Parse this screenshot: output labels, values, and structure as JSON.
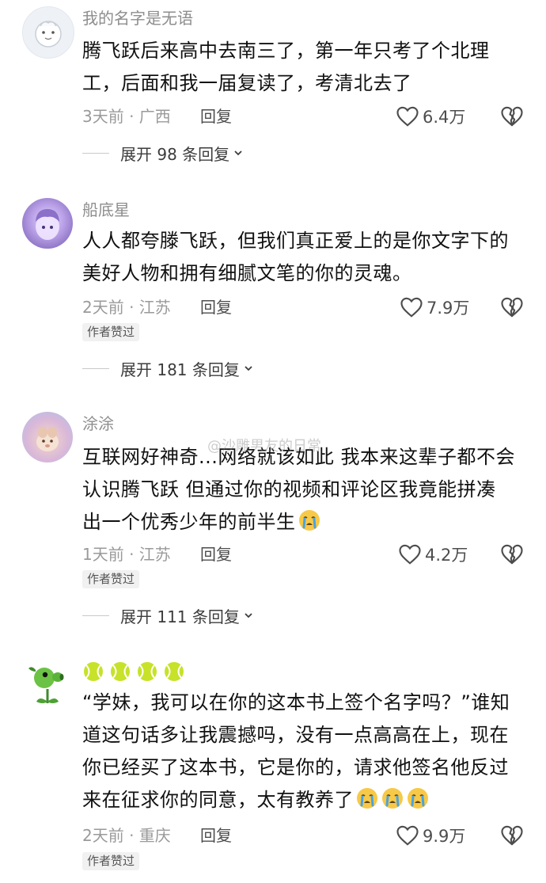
{
  "comments": [
    {
      "username": "我的名字是无语",
      "text_lines": [
        "腾飞跃后来高中去南三了，第一年只考了个北理",
        "工，后面和我一届复读了，考清北去了"
      ],
      "meta": "3天前 · 广西",
      "reply_label": "回复",
      "likes": "6.4万",
      "expand": "展开 98 条回复"
    },
    {
      "username": "船底星",
      "text_lines": [
        "人人都夸滕飞跃，但我们真正爱上的是你文字下的",
        "美好人物和拥有细腻文笔的你的灵魂。"
      ],
      "meta": "2天前 · 江苏",
      "reply_label": "回复",
      "likes": "7.9万",
      "badge": "作者赞过",
      "expand": "展开 181 条回复"
    },
    {
      "username": "涂涂",
      "text_lines": [
        "互联网好神奇...网络就该如此 我本来这辈子都不会",
        "认识腾飞跃 但通过你的视频和评论区我竟能拼凑",
        "出一个优秀少年的前半生"
      ],
      "meta": "1天前 · 江苏",
      "reply_label": "回复",
      "likes": "4.2万",
      "badge": "作者赞过",
      "expand": "展开 111 条回复"
    },
    {
      "text_lines": [
        "“学妹，我可以在你的这本书上签个名字吗？”谁知",
        "道这句话多让我震撼吗，没有一点高高在上，现在",
        "你已经买了这本书，它是你的，请求他签名他反过",
        "来在征求你的同意，太有教养了"
      ],
      "meta": "2天前 · 重庆",
      "reply_label": "回复",
      "likes": "9.9万",
      "badge": "作者赞过"
    }
  ],
  "watermark": "@沙雕男友的日常",
  "colors": {
    "secondary_text": "#9a9a9a",
    "username": "#8d8d8d",
    "badge_bg": "#f1f1f1"
  },
  "icons": [
    "heart-outline-icon",
    "broken-heart-icon",
    "chevron-down-icon",
    "crying-emoji",
    "tennis-ball-emoji"
  ]
}
